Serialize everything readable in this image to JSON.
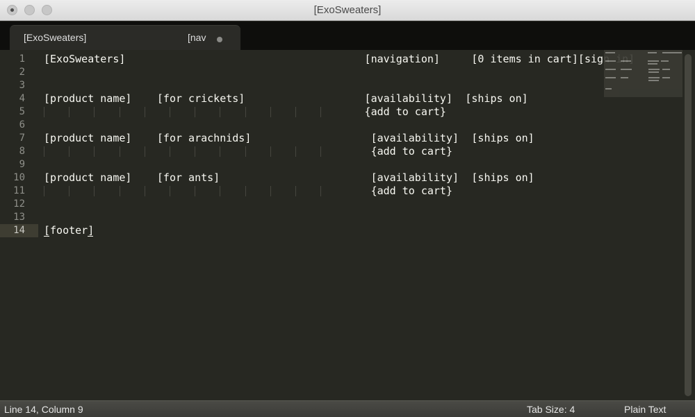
{
  "window": {
    "title": "[ExoSweaters]"
  },
  "tabs": [
    {
      "label": "[ExoSweaters]"
    },
    {
      "label": "[nav"
    }
  ],
  "editor": {
    "active_line": 14,
    "lines": [
      {
        "n": "1",
        "segments": [
          {
            "text": "[ExoSweaters]",
            "col": 0
          },
          {
            "text": "[navigation]",
            "col": 51
          },
          {
            "text": "[0 items in cart][sign in]",
            "col": 68
          }
        ]
      },
      {
        "n": "2",
        "segments": []
      },
      {
        "n": "3",
        "segments": []
      },
      {
        "n": "4",
        "segments": [
          {
            "text": "[product name]",
            "col": 0
          },
          {
            "text": "[for crickets]",
            "col": 18
          },
          {
            "text": "[availability]",
            "col": 51
          },
          {
            "text": "[ships on]",
            "col": 67
          }
        ]
      },
      {
        "n": "5",
        "segments": [
          {
            "text": "{add to cart}",
            "col": 51
          }
        ],
        "guides": 12
      },
      {
        "n": "6",
        "segments": []
      },
      {
        "n": "7",
        "segments": [
          {
            "text": "[product name]",
            "col": 0
          },
          {
            "text": "[for arachnids]",
            "col": 18
          },
          {
            "text": "[availability]",
            "col": 52
          },
          {
            "text": "[ships on]",
            "col": 68
          }
        ]
      },
      {
        "n": "8",
        "segments": [
          {
            "text": "{add to cart}",
            "col": 52
          }
        ],
        "guides": 12
      },
      {
        "n": "9",
        "segments": []
      },
      {
        "n": "10",
        "segments": [
          {
            "text": "[product name]",
            "col": 0
          },
          {
            "text": "[for ants]",
            "col": 18
          },
          {
            "text": "[availability]",
            "col": 52
          },
          {
            "text": "[ships on]",
            "col": 68
          }
        ]
      },
      {
        "n": "11",
        "segments": [
          {
            "text": "{add to cart}",
            "col": 52
          }
        ],
        "guides": 12
      },
      {
        "n": "12",
        "segments": []
      },
      {
        "n": "13",
        "segments": []
      },
      {
        "n": "14",
        "segments": [
          {
            "text": "[footer]",
            "col": 0
          }
        ]
      }
    ]
  },
  "status": {
    "position": "Line 14, Column 9",
    "tab_size": "Tab Size: 4",
    "syntax": "Plain Text"
  },
  "colors": {
    "editor_bg": "#272822",
    "text": "#f8f8f2",
    "gutter_text": "#8f908a",
    "tabbar_bg": "#0e0e0c"
  }
}
